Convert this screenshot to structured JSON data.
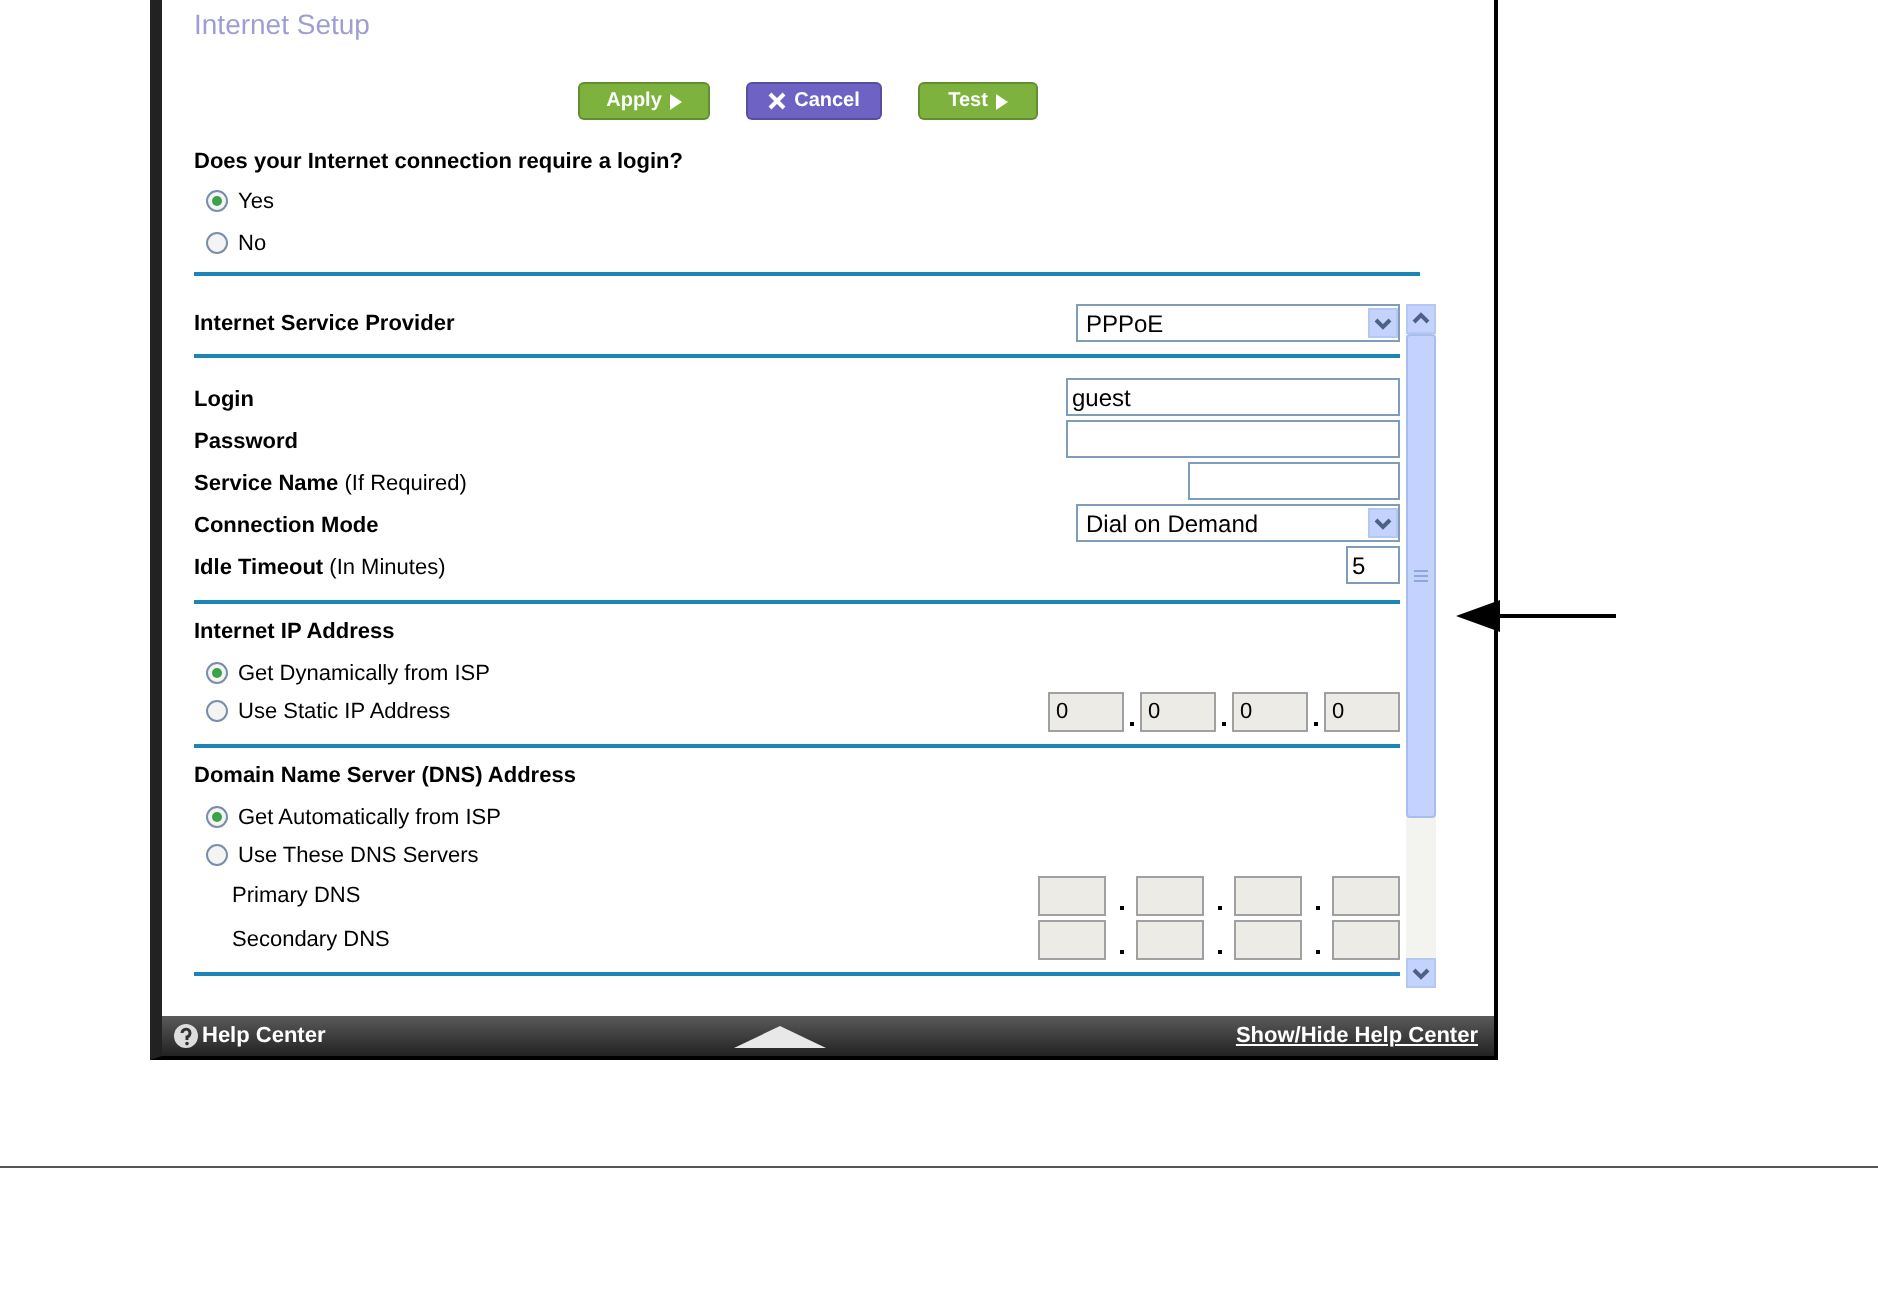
{
  "page_title": "Internet Setup",
  "buttons": [
    {
      "kind": "apply",
      "label": "Apply"
    },
    {
      "kind": "cancel",
      "label": "Cancel"
    },
    {
      "kind": "test",
      "label": "Test"
    }
  ],
  "login_question": {
    "label": "Does your Internet connection require a login?",
    "options": [
      {
        "label": "Yes",
        "selected": true
      },
      {
        "label": "No",
        "selected": false
      }
    ]
  },
  "isp": {
    "label": "Internet Service Provider",
    "value": "PPPoE"
  },
  "fields": [
    {
      "kind": "text",
      "label": "Login",
      "value": "guest"
    },
    {
      "kind": "text",
      "label": "Password"
    },
    {
      "kind": "short_text",
      "label": "Service Name",
      "hint": "(If Required)"
    },
    {
      "kind": "select",
      "label": "Connection Mode",
      "value": "Dial on Demand"
    },
    {
      "kind": "tiny_text",
      "label": "Idle Timeout",
      "hint": "(In Minutes)",
      "value": "5"
    }
  ],
  "internet_ip": {
    "heading": "Internet IP Address",
    "options": [
      {
        "label": "Get Dynamically from ISP",
        "selected": true
      },
      {
        "label": "Use Static IP Address",
        "selected": false,
        "octets": [
          "0",
          "0",
          "0",
          "0"
        ]
      }
    ]
  },
  "dns": {
    "heading": "Domain Name Server (DNS) Address",
    "options": [
      {
        "label": "Get Automatically from ISP",
        "selected": true
      },
      {
        "label": "Use These DNS Servers",
        "selected": false
      }
    ],
    "servers": [
      {
        "label": "Primary DNS"
      },
      {
        "label": "Secondary DNS"
      }
    ]
  },
  "footer": {
    "help": "Help Center",
    "toggle_link": "Show/Hide Help Center"
  }
}
